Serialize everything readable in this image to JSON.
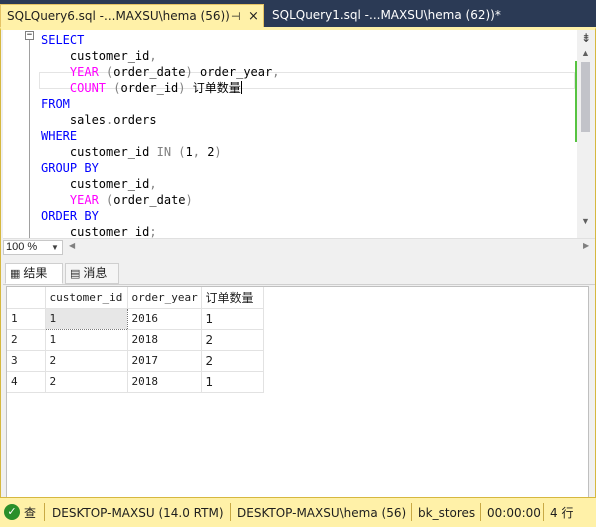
{
  "tabs": {
    "active": {
      "label": "SQLQuery6.sql -...MAXSU\\hema (56))",
      "pin_icon": "pin-icon",
      "close_icon": "close-icon"
    },
    "inactive": {
      "label": "SQLQuery1.sql -...MAXSU\\hema (62))*"
    }
  },
  "editor": {
    "fold_marker": "−",
    "lines": [
      {
        "parts": [
          {
            "t": "SELECT",
            "c": "kw-blue"
          }
        ]
      },
      {
        "parts": [
          {
            "t": "    customer_id",
            "c": ""
          },
          {
            "t": ",",
            "c": "kw-gray"
          }
        ]
      },
      {
        "parts": [
          {
            "t": "    ",
            "c": ""
          },
          {
            "t": "YEAR",
            "c": "kw-pink"
          },
          {
            "t": " (",
            "c": "kw-gray"
          },
          {
            "t": "order_date",
            "c": ""
          },
          {
            "t": ")",
            "c": "kw-gray"
          },
          {
            "t": " order_year",
            "c": ""
          },
          {
            "t": ",",
            "c": "kw-gray"
          }
        ]
      },
      {
        "parts": [
          {
            "t": "    ",
            "c": ""
          },
          {
            "t": "COUNT",
            "c": "kw-pink"
          },
          {
            "t": " (",
            "c": "kw-gray"
          },
          {
            "t": "order_id",
            "c": ""
          },
          {
            "t": ")",
            "c": "kw-gray"
          },
          {
            "t": " 订单数量",
            "c": ""
          }
        ],
        "caret": true
      },
      {
        "parts": [
          {
            "t": "FROM",
            "c": "kw-blue"
          }
        ]
      },
      {
        "parts": [
          {
            "t": "    sales",
            "c": ""
          },
          {
            "t": ".",
            "c": "kw-gray"
          },
          {
            "t": "orders",
            "c": ""
          }
        ]
      },
      {
        "parts": [
          {
            "t": "WHERE",
            "c": "kw-blue"
          }
        ]
      },
      {
        "parts": [
          {
            "t": "    customer_id ",
            "c": ""
          },
          {
            "t": "IN",
            "c": "kw-gray"
          },
          {
            "t": " (",
            "c": "kw-gray"
          },
          {
            "t": "1",
            "c": ""
          },
          {
            "t": ", ",
            "c": "kw-gray"
          },
          {
            "t": "2",
            "c": ""
          },
          {
            "t": ")",
            "c": "kw-gray"
          }
        ]
      },
      {
        "parts": [
          {
            "t": "GROUP BY",
            "c": "kw-blue"
          }
        ]
      },
      {
        "parts": [
          {
            "t": "    customer_id",
            "c": ""
          },
          {
            "t": ",",
            "c": "kw-gray"
          }
        ]
      },
      {
        "parts": [
          {
            "t": "    ",
            "c": ""
          },
          {
            "t": "YEAR",
            "c": "kw-pink"
          },
          {
            "t": " (",
            "c": "kw-gray"
          },
          {
            "t": "order_date",
            "c": ""
          },
          {
            "t": ")",
            "c": "kw-gray"
          }
        ]
      },
      {
        "parts": [
          {
            "t": "ORDER BY",
            "c": "kw-blue"
          }
        ]
      },
      {
        "parts": [
          {
            "t": "    customer_id",
            "c": ""
          },
          {
            "t": ";",
            "c": "kw-gray"
          }
        ]
      }
    ]
  },
  "zoom": {
    "value": "100 %"
  },
  "results_tabs": {
    "results": "结果",
    "messages": "消息",
    "results_icon": "grid-icon",
    "messages_icon": "message-icon"
  },
  "grid": {
    "columns": [
      "customer_id",
      "order_year",
      "订单数量"
    ],
    "rows": [
      {
        "num": "1",
        "cells": [
          "1",
          "2016",
          "1"
        ]
      },
      {
        "num": "2",
        "cells": [
          "1",
          "2018",
          "2"
        ]
      },
      {
        "num": "3",
        "cells": [
          "2",
          "2017",
          "2"
        ]
      },
      {
        "num": "4",
        "cells": [
          "2",
          "2018",
          "1"
        ]
      }
    ]
  },
  "status": {
    "state": "查",
    "server": "DESKTOP-MAXSU (14.0 RTM)",
    "login": "DESKTOP-MAXSU\\hema (56)",
    "database": "bk_stores",
    "elapsed": "00:00:00",
    "rows": "4 行"
  },
  "colors": {
    "tab_active": "#fff1a8",
    "tab_strip": "#2b3a55",
    "keyword": "#0000ff",
    "function": "#ff00ff",
    "operator": "#808080",
    "change_bar": "#57c341",
    "status_bar": "#fff1a8"
  }
}
